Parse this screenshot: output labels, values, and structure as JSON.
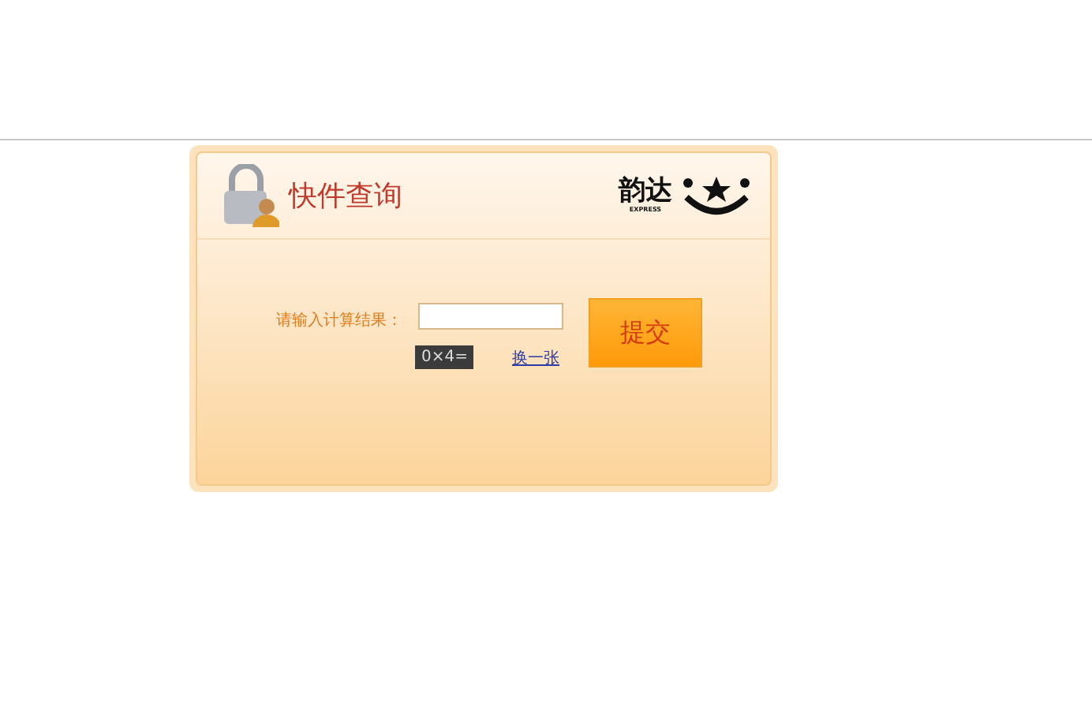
{
  "panel": {
    "title": "快件查询",
    "logo": {
      "name": "韵达",
      "tagline": "EXPRESS"
    }
  },
  "form": {
    "label": "请输入计算结果：",
    "captcha": "0×4=",
    "refresh_link": "换一张",
    "submit": "提交"
  }
}
